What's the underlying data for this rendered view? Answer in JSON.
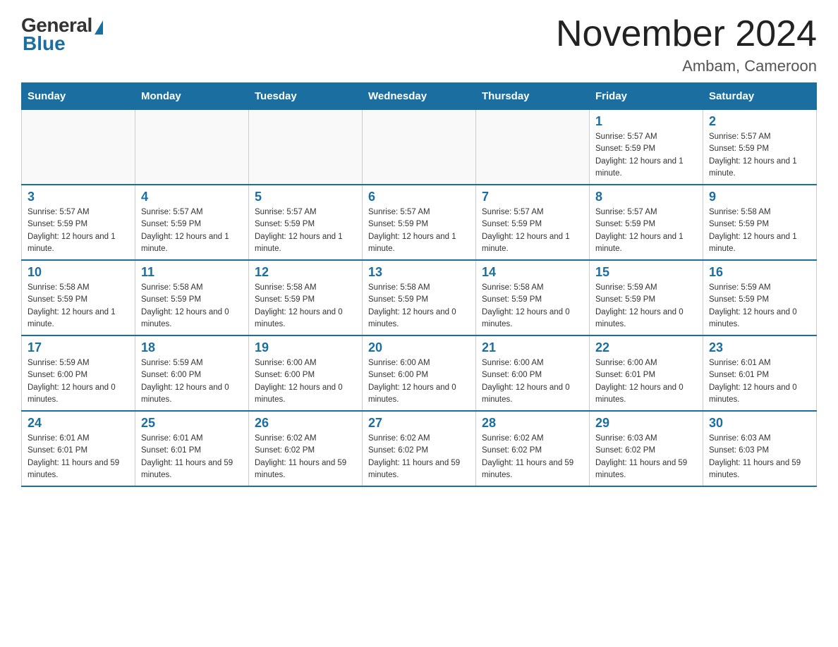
{
  "header": {
    "logo_general": "General",
    "logo_blue": "Blue",
    "month_title": "November 2024",
    "location": "Ambam, Cameroon"
  },
  "weekdays": [
    "Sunday",
    "Monday",
    "Tuesday",
    "Wednesday",
    "Thursday",
    "Friday",
    "Saturday"
  ],
  "weeks": [
    [
      {
        "day": "",
        "info": ""
      },
      {
        "day": "",
        "info": ""
      },
      {
        "day": "",
        "info": ""
      },
      {
        "day": "",
        "info": ""
      },
      {
        "day": "",
        "info": ""
      },
      {
        "day": "1",
        "info": "Sunrise: 5:57 AM\nSunset: 5:59 PM\nDaylight: 12 hours and 1 minute."
      },
      {
        "day": "2",
        "info": "Sunrise: 5:57 AM\nSunset: 5:59 PM\nDaylight: 12 hours and 1 minute."
      }
    ],
    [
      {
        "day": "3",
        "info": "Sunrise: 5:57 AM\nSunset: 5:59 PM\nDaylight: 12 hours and 1 minute."
      },
      {
        "day": "4",
        "info": "Sunrise: 5:57 AM\nSunset: 5:59 PM\nDaylight: 12 hours and 1 minute."
      },
      {
        "day": "5",
        "info": "Sunrise: 5:57 AM\nSunset: 5:59 PM\nDaylight: 12 hours and 1 minute."
      },
      {
        "day": "6",
        "info": "Sunrise: 5:57 AM\nSunset: 5:59 PM\nDaylight: 12 hours and 1 minute."
      },
      {
        "day": "7",
        "info": "Sunrise: 5:57 AM\nSunset: 5:59 PM\nDaylight: 12 hours and 1 minute."
      },
      {
        "day": "8",
        "info": "Sunrise: 5:57 AM\nSunset: 5:59 PM\nDaylight: 12 hours and 1 minute."
      },
      {
        "day": "9",
        "info": "Sunrise: 5:58 AM\nSunset: 5:59 PM\nDaylight: 12 hours and 1 minute."
      }
    ],
    [
      {
        "day": "10",
        "info": "Sunrise: 5:58 AM\nSunset: 5:59 PM\nDaylight: 12 hours and 1 minute."
      },
      {
        "day": "11",
        "info": "Sunrise: 5:58 AM\nSunset: 5:59 PM\nDaylight: 12 hours and 0 minutes."
      },
      {
        "day": "12",
        "info": "Sunrise: 5:58 AM\nSunset: 5:59 PM\nDaylight: 12 hours and 0 minutes."
      },
      {
        "day": "13",
        "info": "Sunrise: 5:58 AM\nSunset: 5:59 PM\nDaylight: 12 hours and 0 minutes."
      },
      {
        "day": "14",
        "info": "Sunrise: 5:58 AM\nSunset: 5:59 PM\nDaylight: 12 hours and 0 minutes."
      },
      {
        "day": "15",
        "info": "Sunrise: 5:59 AM\nSunset: 5:59 PM\nDaylight: 12 hours and 0 minutes."
      },
      {
        "day": "16",
        "info": "Sunrise: 5:59 AM\nSunset: 5:59 PM\nDaylight: 12 hours and 0 minutes."
      }
    ],
    [
      {
        "day": "17",
        "info": "Sunrise: 5:59 AM\nSunset: 6:00 PM\nDaylight: 12 hours and 0 minutes."
      },
      {
        "day": "18",
        "info": "Sunrise: 5:59 AM\nSunset: 6:00 PM\nDaylight: 12 hours and 0 minutes."
      },
      {
        "day": "19",
        "info": "Sunrise: 6:00 AM\nSunset: 6:00 PM\nDaylight: 12 hours and 0 minutes."
      },
      {
        "day": "20",
        "info": "Sunrise: 6:00 AM\nSunset: 6:00 PM\nDaylight: 12 hours and 0 minutes."
      },
      {
        "day": "21",
        "info": "Sunrise: 6:00 AM\nSunset: 6:00 PM\nDaylight: 12 hours and 0 minutes."
      },
      {
        "day": "22",
        "info": "Sunrise: 6:00 AM\nSunset: 6:01 PM\nDaylight: 12 hours and 0 minutes."
      },
      {
        "day": "23",
        "info": "Sunrise: 6:01 AM\nSunset: 6:01 PM\nDaylight: 12 hours and 0 minutes."
      }
    ],
    [
      {
        "day": "24",
        "info": "Sunrise: 6:01 AM\nSunset: 6:01 PM\nDaylight: 11 hours and 59 minutes."
      },
      {
        "day": "25",
        "info": "Sunrise: 6:01 AM\nSunset: 6:01 PM\nDaylight: 11 hours and 59 minutes."
      },
      {
        "day": "26",
        "info": "Sunrise: 6:02 AM\nSunset: 6:02 PM\nDaylight: 11 hours and 59 minutes."
      },
      {
        "day": "27",
        "info": "Sunrise: 6:02 AM\nSunset: 6:02 PM\nDaylight: 11 hours and 59 minutes."
      },
      {
        "day": "28",
        "info": "Sunrise: 6:02 AM\nSunset: 6:02 PM\nDaylight: 11 hours and 59 minutes."
      },
      {
        "day": "29",
        "info": "Sunrise: 6:03 AM\nSunset: 6:02 PM\nDaylight: 11 hours and 59 minutes."
      },
      {
        "day": "30",
        "info": "Sunrise: 6:03 AM\nSunset: 6:03 PM\nDaylight: 11 hours and 59 minutes."
      }
    ]
  ]
}
